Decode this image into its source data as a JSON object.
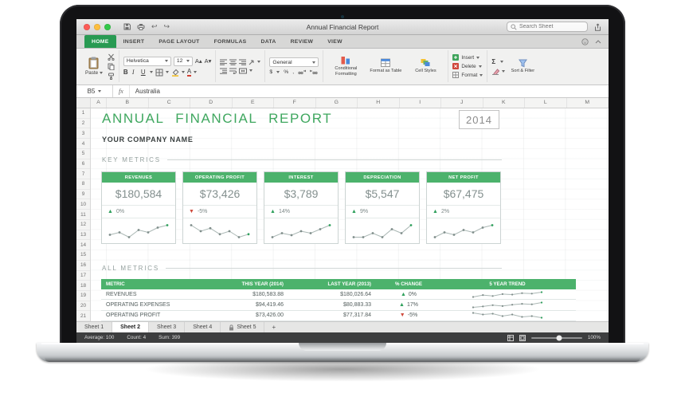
{
  "titlebar": {
    "title": "Annual Financial Report",
    "search_placeholder": "Search Sheet"
  },
  "ribbon_tabs": [
    {
      "label": "HOME",
      "active": true
    },
    {
      "label": "INSERT"
    },
    {
      "label": "PAGE LAYOUT"
    },
    {
      "label": "FORMULAS"
    },
    {
      "label": "DATA"
    },
    {
      "label": "REVIEW"
    },
    {
      "label": "VIEW"
    }
  ],
  "ribbon": {
    "paste_label": "Paste",
    "font_name": "Helvetica",
    "font_size": "12",
    "bold": "B",
    "italic": "I",
    "underline": "U",
    "font_grow": "A",
    "font_shrink": "A",
    "font_color_letter": "A",
    "number_format": "General",
    "currency": "$",
    "percent": "%",
    "comma": ",",
    "conditional_formatting": "Conditional Formatting",
    "format_as_table": "Format as Table",
    "cell_styles": "Cell Styles",
    "insert_label": "Insert",
    "delete_label": "Delete",
    "format_label": "Format",
    "autosum": "Σ",
    "sort_filter": "Sort & Filter"
  },
  "formula_bar": {
    "cell_ref": "B5",
    "fx": "fx",
    "content": "Australia"
  },
  "grid": {
    "columns": [
      "A",
      "B",
      "C",
      "D",
      "E",
      "F",
      "G",
      "H",
      "I",
      "J",
      "K",
      "L",
      "M"
    ],
    "row_count": 21
  },
  "report": {
    "title": "ANNUAL FINANCIAL REPORT",
    "year": "2014",
    "company": "YOUR COMPANY NAME",
    "key_metrics_label": "KEY METRICS",
    "all_metrics_label": "ALL METRICS",
    "colors": {
      "accent": "#4cb26c",
      "title_green": "#3fa75f",
      "up": "#2fa05c",
      "down": "#cf4a3c",
      "spark_line": "#aab7b4",
      "spark_dot": "#7f8d8a",
      "spark_end": "#2fa05c"
    },
    "cards": [
      {
        "label": "REVENUES",
        "value": "$180,584",
        "arrow": "▲",
        "change": "0%",
        "color": "#2fa05c",
        "spark": [
          3,
          3.1,
          2.9,
          3.2,
          3.1,
          3.3,
          3.4
        ]
      },
      {
        "label": "OPERATING PROFIT",
        "value": "$73,426",
        "arrow": "▼",
        "change": "-5%",
        "color": "#cf4a3c",
        "spark": [
          3.2,
          3,
          3.1,
          2.9,
          3,
          2.8,
          2.9
        ]
      },
      {
        "label": "INTEREST",
        "value": "$3,789",
        "arrow": "▲",
        "change": "14%",
        "color": "#2fa05c",
        "spark": [
          2.8,
          3,
          2.9,
          3.1,
          3,
          3.2,
          3.4
        ]
      },
      {
        "label": "DEPRECIATION",
        "value": "$5,547",
        "arrow": "▲",
        "change": "9%",
        "color": "#2fa05c",
        "spark": [
          3,
          3,
          3.1,
          3,
          3.2,
          3.1,
          3.3
        ]
      },
      {
        "label": "NET PROFIT",
        "value": "$67,475",
        "arrow": "▲",
        "change": "2%",
        "color": "#2fa05c",
        "spark": [
          2.9,
          3.1,
          3,
          3.2,
          3.1,
          3.3,
          3.4
        ]
      }
    ],
    "table": {
      "headers": [
        "METRIC",
        "THIS YEAR (2014)",
        "LAST YEAR (2013)",
        "% CHANGE",
        "5 YEAR TREND"
      ],
      "rows": [
        {
          "metric": "REVENUES",
          "this_year": "$180,583.88",
          "last_year": "$180,026.64",
          "arrow": "▲",
          "change": "0%",
          "color": "#2fa05c",
          "spark": [
            2,
            2.4,
            2.2,
            2.6,
            2.5,
            2.8,
            2.7,
            3
          ]
        },
        {
          "metric": "OPERATING EXPENSES",
          "this_year": "$94,419.46",
          "last_year": "$80,883.33",
          "arrow": "▲",
          "change": "17%",
          "color": "#2fa05c",
          "spark": [
            2,
            2.2,
            2.5,
            2.3,
            2.6,
            2.8,
            2.7,
            3.1
          ]
        },
        {
          "metric": "OPERATING PROFIT",
          "this_year": "$73,426.00",
          "last_year": "$77,317.84",
          "arrow": "▼",
          "change": "-5%",
          "color": "#cf4a3c",
          "spark": [
            3,
            2.8,
            2.9,
            2.6,
            2.8,
            2.5,
            2.6,
            2.4
          ]
        }
      ]
    }
  },
  "sheet_tabs": [
    {
      "label": "Sheet 1"
    },
    {
      "label": "Sheet 2",
      "active": true
    },
    {
      "label": "Sheet 3"
    },
    {
      "label": "Sheet 4"
    },
    {
      "label": "Sheet 5",
      "locked": true
    }
  ],
  "sheet_add": "+",
  "status_bar": {
    "items": [
      "Average: 100",
      "Count: 4",
      "Sum: 399"
    ],
    "zoom": "100%"
  }
}
